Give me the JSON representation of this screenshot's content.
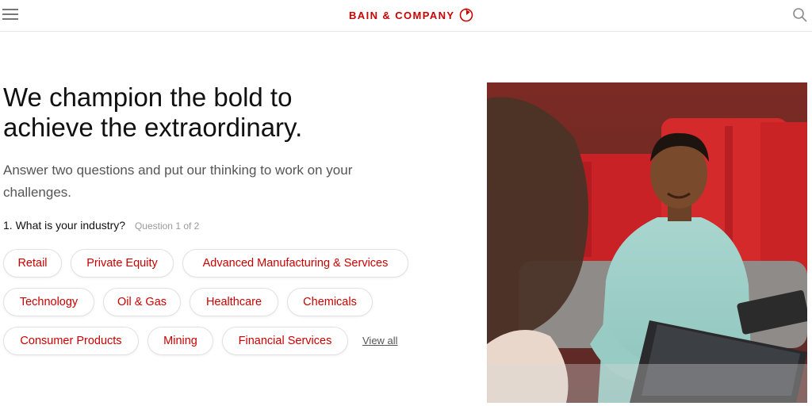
{
  "header": {
    "logo_text": "BAIN & COMPANY",
    "brand_color": "#cc0000",
    "menu_icon": "hamburger-menu-icon",
    "search_icon": "search-icon"
  },
  "hero": {
    "title_line1": "We champion the bold to",
    "title_line2": "achieve the extraordinary.",
    "subtitle": "Answer two questions and put our thinking to work on your challenges."
  },
  "question": {
    "label": "1. What is your industry?",
    "counter": "Question 1 of 2"
  },
  "industries": [
    "Retail",
    "Private Equity",
    "Advanced Manufacturing & Services",
    "Technology",
    "Oil & Gas",
    "Healthcare",
    "Chemicals",
    "Consumer Products",
    "Mining",
    "Financial Services"
  ],
  "view_all_label": "View all"
}
